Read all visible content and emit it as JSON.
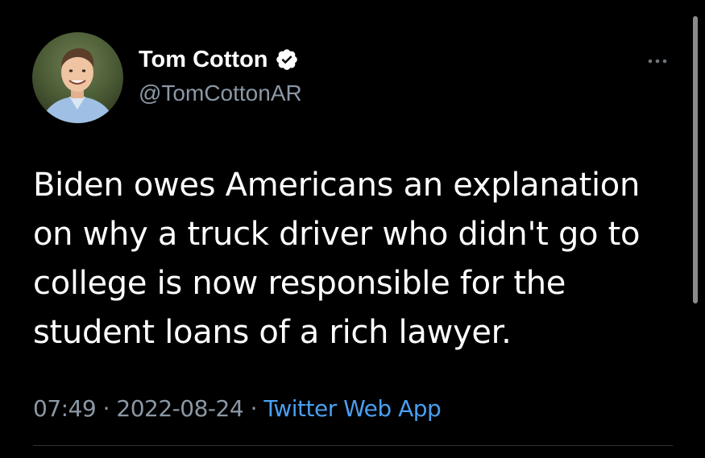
{
  "colors": {
    "background": "#000000",
    "text_primary": "#ffffff",
    "text_secondary": "#8b98a5",
    "link": "#4a9ff0",
    "divider": "#2f3336",
    "scrollbar": "#8a8a8a"
  },
  "author": {
    "display_name": "Tom Cotton",
    "handle": "@TomCottonAR",
    "verified": true,
    "avatar_icon": "profile-photo"
  },
  "tweet": {
    "text": "Biden owes Americans an explanation on why a truck driver who didn't go to college is now responsible for the student loans of a rich lawyer.",
    "time": "07:49",
    "separator": "·",
    "date": "2022-08-24",
    "source": "Twitter Web App"
  },
  "icons": {
    "more": "more-horizontal-icon",
    "verified": "verified-badge-icon"
  }
}
